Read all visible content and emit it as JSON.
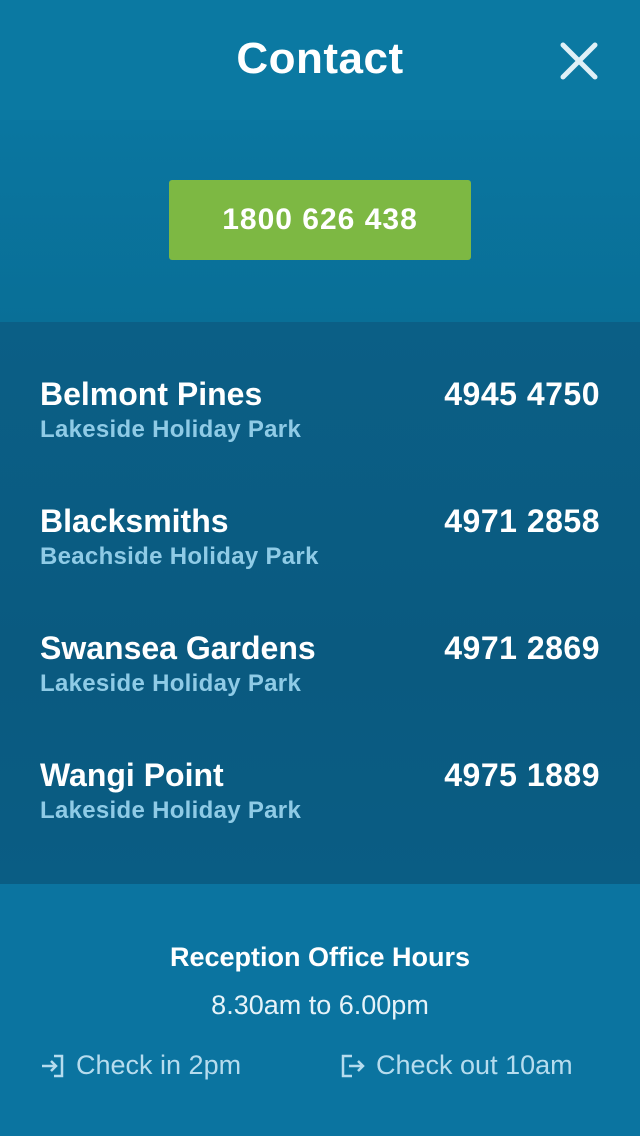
{
  "header": {
    "title": "Contact",
    "close_icon": "close-icon"
  },
  "hero": {
    "phone_label": "1800 626 438",
    "button_color": "#7db843"
  },
  "parks": [
    {
      "name": "Belmont Pines",
      "type": "Lakeside Holiday Park",
      "phone": "4945 4750"
    },
    {
      "name": "Blacksmiths",
      "type": "Beachside Holiday Park",
      "phone": "4971 2858"
    },
    {
      "name": "Swansea Gardens",
      "type": "Lakeside Holiday Park",
      "phone": "4971 2869"
    },
    {
      "name": "Wangi Point",
      "type": "Lakeside Holiday Park",
      "phone": "4975 1889"
    }
  ],
  "footer": {
    "hours_title": "Reception Office Hours",
    "hours_value": "8.30am to 6.00pm",
    "check_in": "Check in 2pm",
    "check_out": "Check out 10am",
    "check_in_icon": "sign-in-icon",
    "check_out_icon": "sign-out-icon"
  },
  "colors": {
    "header_bg": "#0b79a2",
    "list_bg": "#0b5f86",
    "subtitle_text": "#8fcbe6"
  }
}
